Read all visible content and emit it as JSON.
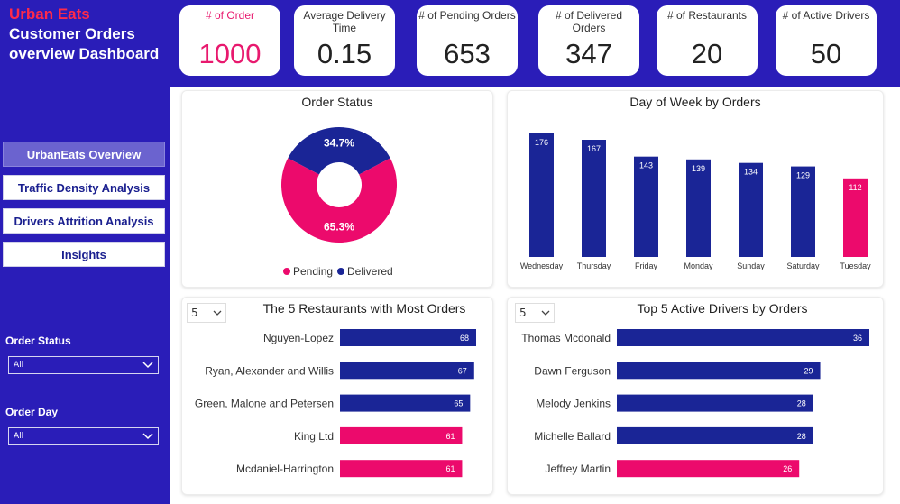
{
  "header": {
    "brand": "Urban Eats",
    "title": "Customer Orders overview Dashboard"
  },
  "nav": {
    "items": [
      {
        "label": "UrbanEats Overview",
        "active": true
      },
      {
        "label": "Traffic Density Analysis",
        "active": false
      },
      {
        "label": "Drivers Attrition Analysis",
        "active": false
      },
      {
        "label": "Insights",
        "active": false
      }
    ]
  },
  "filters": {
    "order_status": {
      "label": "Order Status",
      "value": "All"
    },
    "order_day": {
      "label": "Order Day",
      "value": "All"
    }
  },
  "kpis": [
    {
      "label": "# of Order",
      "value": "1000"
    },
    {
      "label": "Average Delivery Time",
      "value": "0.15"
    },
    {
      "label": "# of Pending Orders",
      "value": "653"
    },
    {
      "label": "# of Delivered Orders",
      "value": "347"
    },
    {
      "label": "# of Restaurants",
      "value": "20"
    },
    {
      "label": "# of Active Drivers",
      "value": "50"
    }
  ],
  "colors": {
    "navy": "#1A2596",
    "pink": "#EC0A6C",
    "sidebar": "#2A1DB8"
  },
  "topn_selector": "5",
  "chart_data": [
    {
      "type": "pie",
      "title": "Order Status",
      "categories": [
        "Pending",
        "Delivered"
      ],
      "values": [
        65.3,
        34.7
      ],
      "value_labels": [
        "65.3%",
        "34.7%"
      ],
      "colors": [
        "#EC0A6C",
        "#1A2596"
      ],
      "legend": "bottom",
      "donut": true
    },
    {
      "type": "bar",
      "title": "Day of Week by Orders",
      "categories": [
        "Wednesday",
        "Thursday",
        "Friday",
        "Monday",
        "Sunday",
        "Saturday",
        "Tuesday"
      ],
      "values": [
        176,
        167,
        143,
        139,
        134,
        129,
        112
      ],
      "highlight": "Tuesday",
      "ylim": [
        0,
        176
      ]
    },
    {
      "type": "bar",
      "orientation": "horizontal",
      "title": "The 5 Restaurants with Most Orders",
      "categories": [
        "Nguyen-Lopez",
        "Ryan, Alexander and Willis",
        "Green, Malone and Petersen",
        "King Ltd",
        "Mcdaniel-Harrington"
      ],
      "values": [
        68,
        67,
        65,
        61,
        61
      ],
      "highlight_indices": [
        3,
        4
      ],
      "xlim": [
        0,
        68
      ]
    },
    {
      "type": "bar",
      "orientation": "horizontal",
      "title": "Top 5 Active Drivers by Orders",
      "categories": [
        "Thomas Mcdonald",
        "Dawn Ferguson",
        "Melody Jenkins",
        "Michelle Ballard",
        "Jeffrey Martin"
      ],
      "values": [
        36,
        29,
        28,
        28,
        26
      ],
      "highlight_indices": [
        4
      ],
      "xlim": [
        0,
        36
      ]
    }
  ]
}
